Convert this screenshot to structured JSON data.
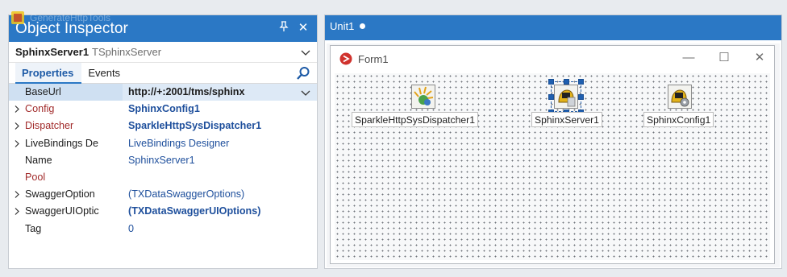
{
  "inspector": {
    "ghost_title": "GenerateHttpTools",
    "title": "Object Inspector",
    "pin_glyph": "3",
    "close_glyph": "✕",
    "selected_object": "SphinxServer1",
    "selected_class": "TSphinxServer",
    "tabs": [
      {
        "label": "Properties",
        "active": true
      },
      {
        "label": "Events",
        "active": false
      }
    ],
    "properties": [
      {
        "name": "BaseUrl",
        "value": "http://+:2001/tms/sphinx",
        "expandable": false,
        "reference": false,
        "value_style": "bold",
        "selected": true,
        "dropdown": true
      },
      {
        "name": "Config",
        "value": "SphinxConfig1",
        "expandable": true,
        "reference": true,
        "value_style": "blue-bold"
      },
      {
        "name": "Dispatcher",
        "value": "SparkleHttpSysDispatcher1",
        "expandable": true,
        "reference": true,
        "value_style": "blue-bold"
      },
      {
        "name": "LiveBindings De",
        "value": "LiveBindings Designer",
        "expandable": true,
        "reference": false,
        "value_style": "blue"
      },
      {
        "name": "Name",
        "value": "SphinxServer1",
        "expandable": false,
        "reference": false,
        "value_style": "blue"
      },
      {
        "name": "Pool",
        "value": "",
        "expandable": false,
        "reference": true,
        "value_style": "blue"
      },
      {
        "name": "SwaggerOption",
        "value": "(TXDataSwaggerOptions)",
        "expandable": true,
        "reference": false,
        "value_style": "blue"
      },
      {
        "name": "SwaggerUIOptic",
        "value": "(TXDataSwaggerUIOptions)",
        "expandable": true,
        "reference": false,
        "value_style": "blue-bold"
      },
      {
        "name": "Tag",
        "value": "0",
        "expandable": false,
        "reference": false,
        "value_style": "blue"
      }
    ]
  },
  "designer": {
    "tab_label": "Unit1",
    "form_title": "Form1",
    "window_min": "—",
    "window_max": "☐",
    "window_close": "✕",
    "components": [
      {
        "label": "SparkleHttpSysDispatcher1",
        "icon": "sparkle-dispatcher-icon",
        "selected": false
      },
      {
        "label": "SphinxServer1",
        "icon": "sphinx-server-icon",
        "selected": true
      },
      {
        "label": "SphinxConfig1",
        "icon": "sphinx-config-icon",
        "selected": false
      }
    ]
  },
  "colors": {
    "titlebar": "#2b78c5",
    "reference_property": "#a12a2a",
    "value_blue": "#1e4f9c",
    "selection": "#1f5fb0"
  }
}
